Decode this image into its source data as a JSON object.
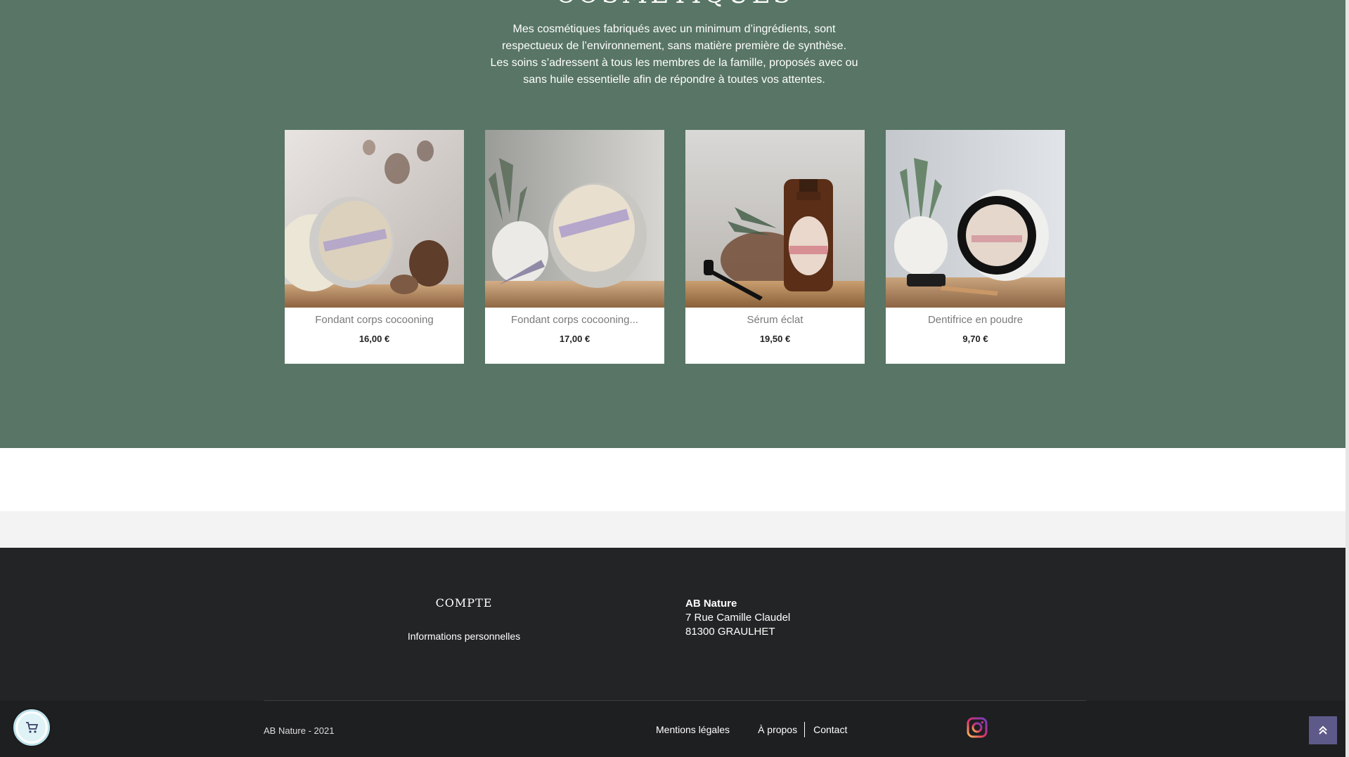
{
  "section": {
    "heading": "COSMÉTIQUES",
    "intro_lines": [
      "Mes cosmétiques fabriqués avec un minimum d’ingrédients, sont",
      "respectueux de l’environnement, sans matière première de synthèse.",
      "Les soins s’adressent à tous les membres de la famille, proposés avec ou",
      "sans huile essentielle afin de répondre à toutes vos attentes."
    ]
  },
  "products": [
    {
      "name": "Fondant corps cocooning",
      "price": "16,00 €",
      "image": "eucalyptus-pinecone-tin-photo"
    },
    {
      "name": "Fondant corps cocooning...",
      "price": "17,00 €",
      "image": "lavender-tin-photo"
    },
    {
      "name": "Sérum éclat",
      "price": "19,50 €",
      "image": "amber-dropper-bottle-photo"
    },
    {
      "name": "Dentifrice en poudre",
      "price": "9,70 €",
      "image": "toothpowder-jar-photo"
    }
  ],
  "footer": {
    "compte_title": "COMPTE",
    "compte_link": "Informations personnelles",
    "company_name": "AB Nature",
    "address_line1": "7 Rue Camille Claudel",
    "address_line2": "81300 GRAULHET",
    "copyright": "AB Nature - 2021",
    "links": {
      "mentions": "Mentions légales",
      "apropos": "À propos",
      "contact": "Contact"
    },
    "social_icon": "instagram-icon"
  },
  "widgets": {
    "back_to_top_icon": "double-chevron-up-icon",
    "cart_icon": "cart-icon"
  },
  "colors": {
    "section_bg": "#587565",
    "footer_bg": "#232425",
    "back_to_top_bg": "#5d5a8a"
  }
}
